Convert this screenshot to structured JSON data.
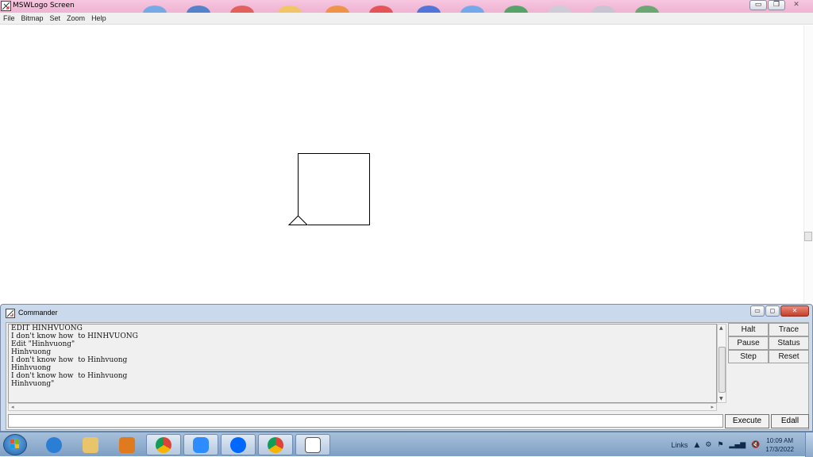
{
  "window": {
    "title": "MSWLogo Screen",
    "menu": [
      "File",
      "Bitmap",
      "Set",
      "Zoom",
      "Help"
    ]
  },
  "commander": {
    "title": "Commander",
    "history": [
      "EDIT HINHVUONG",
      "I don't know how  to HINHVUONG",
      "Edit \"Hinhvuong\"",
      "Hinhvuong",
      "I don't know how  to Hinhvuong",
      "Hinhvuong",
      "I don't know how  to Hinhvuong",
      "Hinhvuong\""
    ],
    "input_value": "",
    "buttons": {
      "halt": "Halt",
      "trace": "Trace",
      "pause": "Pause",
      "status": "Status",
      "step": "Step",
      "reset": "Reset",
      "execute": "Execute",
      "edall": "Edall"
    }
  },
  "taskbar": {
    "apps": [
      {
        "name": "internet-explorer",
        "color": "#2a7fd4"
      },
      {
        "name": "file-explorer",
        "color": "#e8c46a"
      },
      {
        "name": "media-player",
        "color": "#e07a1f"
      },
      {
        "name": "chrome",
        "color": "#db4437"
      },
      {
        "name": "zoom",
        "color": "#2d8cff"
      },
      {
        "name": "zalo",
        "color": "#0068ff"
      },
      {
        "name": "chrome-user",
        "color": "#3aa757"
      },
      {
        "name": "mswlogo",
        "color": "#ffffff"
      }
    ],
    "links_label": "Links",
    "time": "10:09 AM",
    "date": "17/3/2022"
  },
  "colors": {
    "titlebar": "#f6c6df",
    "commander_frame": "#cbd9ec",
    "taskbar": "#a7c0da"
  }
}
